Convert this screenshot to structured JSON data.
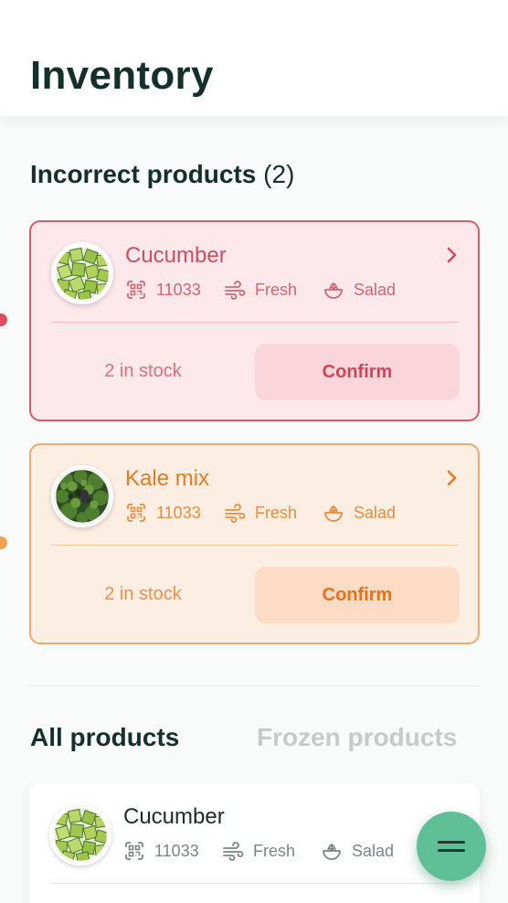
{
  "header": {
    "title": "Inventory"
  },
  "incorrect": {
    "title": "Incorrect products",
    "count": "(2)",
    "items": [
      {
        "name": "Cucumber",
        "code": "11033",
        "state": "Fresh",
        "category": "Salad",
        "stock": "2 in stock",
        "action": "Confirm",
        "tone": "red",
        "image": "cucumber-image"
      },
      {
        "name": "Kale mix",
        "code": "11033",
        "state": "Fresh",
        "category": "Salad",
        "stock": "2 in stock",
        "action": "Confirm",
        "tone": "orange",
        "image": "kale-image"
      }
    ]
  },
  "tabs": {
    "all": "All products",
    "frozen": "Frozen products"
  },
  "all_products": {
    "items": [
      {
        "name": "Cucumber",
        "code": "11033",
        "state": "Fresh",
        "category": "Salad",
        "image": "cucumber-image"
      }
    ]
  },
  "colors": {
    "red": "#d64c5c",
    "orange": "#ea7a1e",
    "accent": "#5fbf96",
    "dark": "#15302a"
  },
  "icons": [
    "chevron-right-icon",
    "qr-code-icon",
    "wind-icon",
    "salad-bowl-icon",
    "menu-icon"
  ]
}
